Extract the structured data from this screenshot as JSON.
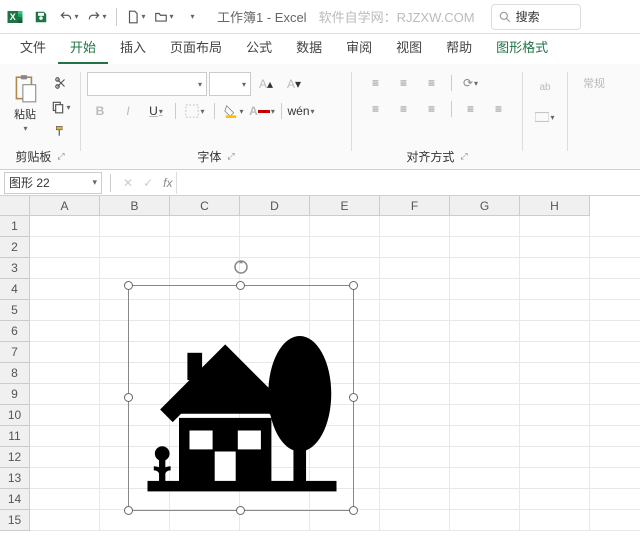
{
  "titlebar": {
    "doc_title": "工作簿1 - Excel",
    "watermark": "软件自学网：RJZXW.COM",
    "search_placeholder": "搜索"
  },
  "tabs": {
    "items": [
      {
        "label": "文件"
      },
      {
        "label": "开始"
      },
      {
        "label": "插入"
      },
      {
        "label": "页面布局"
      },
      {
        "label": "公式"
      },
      {
        "label": "数据"
      },
      {
        "label": "审阅"
      },
      {
        "label": "视图"
      },
      {
        "label": "帮助"
      },
      {
        "label": "图形格式"
      }
    ],
    "active_index": 1
  },
  "ribbon": {
    "clipboard": {
      "label": "剪贴板",
      "paste": "粘贴"
    },
    "font": {
      "label": "字体",
      "bold": "B",
      "italic": "I",
      "underline": "U",
      "wen": "wén"
    },
    "alignment": {
      "label": "对齐方式",
      "wrap": "ab"
    },
    "general": {
      "label": "常规"
    }
  },
  "namebox": {
    "value": "图形 22"
  },
  "formula": {
    "label": "fx",
    "value": ""
  },
  "columns": [
    "A",
    "B",
    "C",
    "D",
    "E",
    "F",
    "G",
    "H"
  ],
  "rows": [
    "1",
    "2",
    "3",
    "4",
    "5",
    "6",
    "7",
    "8",
    "9",
    "10",
    "11",
    "12",
    "13",
    "14",
    "15"
  ],
  "shape": {
    "name": "house-tree-icon"
  }
}
